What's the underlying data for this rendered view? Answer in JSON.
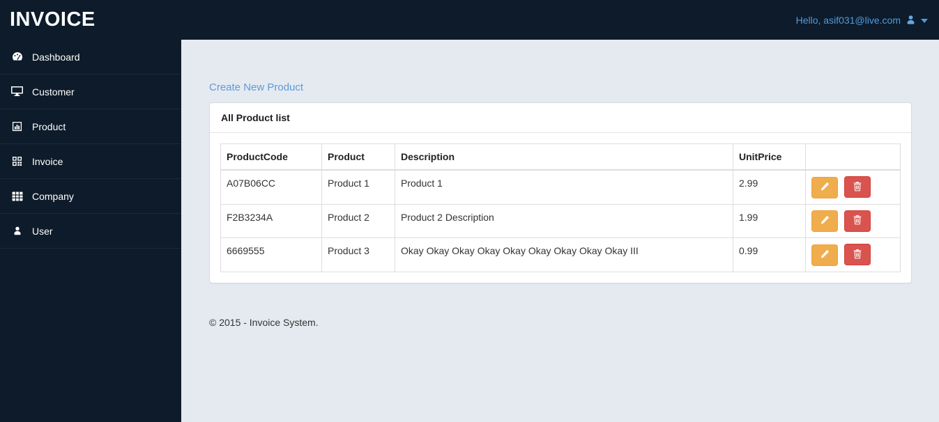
{
  "navbar": {
    "brand": "INVOICE",
    "user_greeting": "Hello, asif031@live.com"
  },
  "sidebar": {
    "items": [
      {
        "label": "Dashboard",
        "icon": "dashboard-icon"
      },
      {
        "label": "Customer",
        "icon": "desktop-icon"
      },
      {
        "label": "Product",
        "icon": "bar-chart-icon"
      },
      {
        "label": "Invoice",
        "icon": "qrcode-icon"
      },
      {
        "label": "Company",
        "icon": "table-icon"
      },
      {
        "label": "User",
        "icon": "user-icon"
      }
    ]
  },
  "main": {
    "create_link": "Create New Product",
    "panel_title": "All Product list",
    "table": {
      "headers": [
        "ProductCode",
        "Product",
        "Description",
        "UnitPrice",
        ""
      ],
      "rows": [
        {
          "code": "A07B06CC",
          "product": "Product 1",
          "description": "Product 1",
          "price": "2.99"
        },
        {
          "code": "F2B3234A",
          "product": "Product 2",
          "description": "Product 2 Description",
          "price": "1.99"
        },
        {
          "code": "6669555",
          "product": "Product 3",
          "description": "Okay Okay Okay Okay Okay Okay Okay Okay Okay III",
          "price": "0.99"
        }
      ],
      "actions": {
        "edit_title": "Edit",
        "delete_title": "Delete"
      }
    },
    "footer": "© 2015 - Invoice System."
  },
  "colors": {
    "navbar_bg": "#0d1b2a",
    "sidebar_bg": "#0d1b2a",
    "content_bg": "#e5eaf1",
    "link_blue": "#5b9bd8",
    "greeting_blue": "#4f9cdf",
    "edit_button": "#f0ad4e",
    "delete_button": "#d9534f",
    "table_border": "#dddddd"
  }
}
